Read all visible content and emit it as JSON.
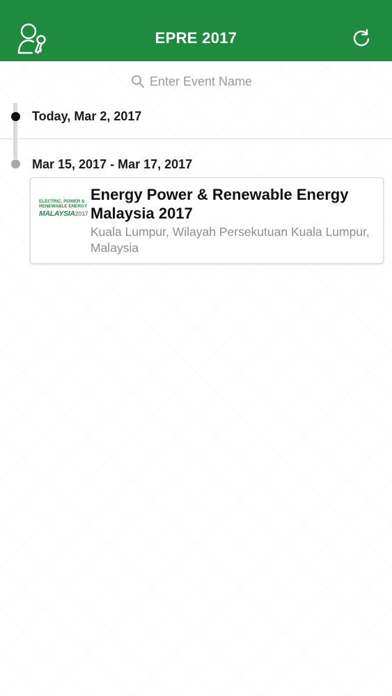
{
  "header": {
    "title": "EPRE 2017",
    "background_color": "#1f8b3f",
    "left_icon": "user-key-icon",
    "right_icon": "refresh-icon"
  },
  "search": {
    "placeholder": "Enter Event Name",
    "value": "",
    "icon": "search-icon"
  },
  "timeline": {
    "today_label": "Today, Mar 2, 2017",
    "groups": [
      {
        "date_range": "Mar 15, 2017 - Mar 17, 2017",
        "events": [
          {
            "title": "Energy Power & Renewable Energy Malaysia 2017",
            "location": "Kuala Lumpur, Wilayah Persekutuan Kuala Lumpur, Malaysia",
            "logo": {
              "line1": "ELECTRIC, POWER &",
              "line2": "RENEWABLE ENERGY",
              "line3": "MALAYSIA",
              "year": "2017"
            }
          }
        ]
      }
    ]
  },
  "colors": {
    "brand_green": "#1f8b3f",
    "today_dot": "#111111",
    "event_dot": "#a8a8a8",
    "secondary_text": "#8d8d8d"
  }
}
